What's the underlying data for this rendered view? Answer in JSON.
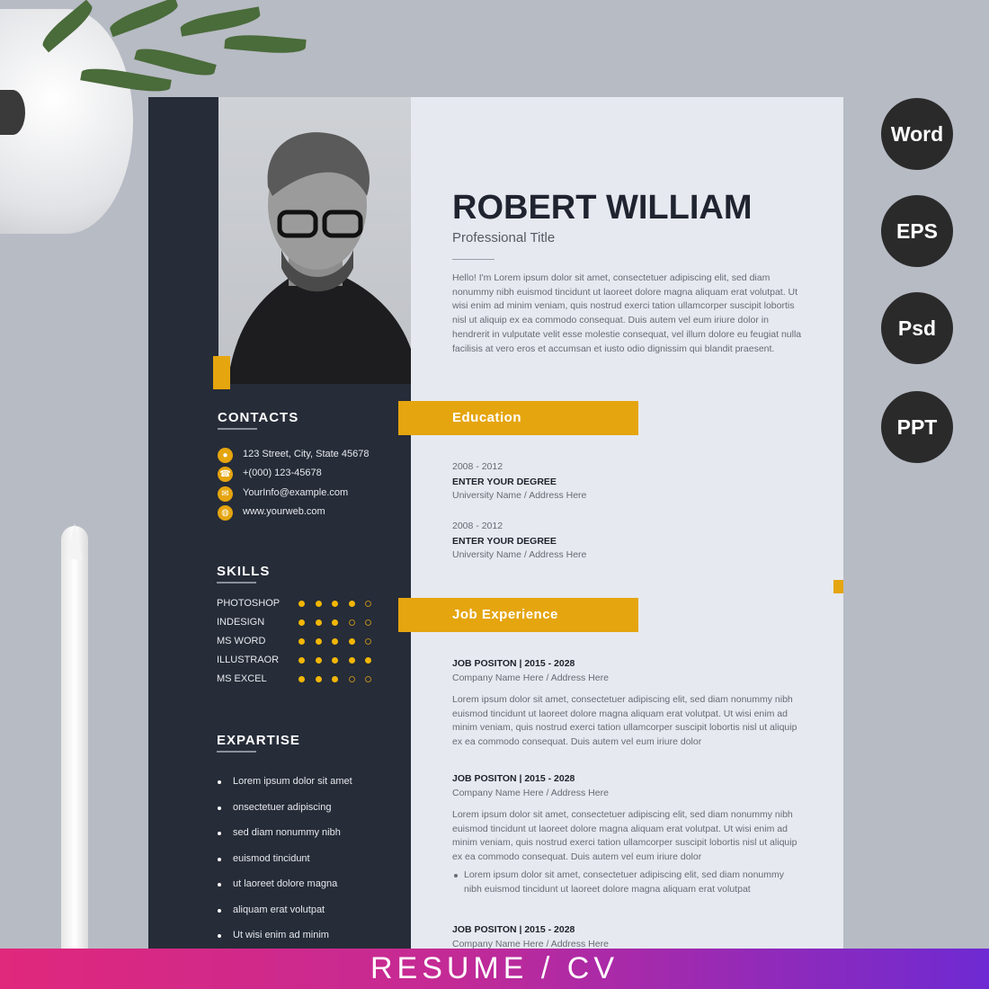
{
  "resume": {
    "name": "ROBERT WILLIAM",
    "title": "Professional Title",
    "about": "Hello! I'm Lorem ipsum dolor sit amet, consectetuer adipiscing elit, sed diam nonummy nibh euismod tincidunt ut laoreet dolore magna aliquam erat volutpat. Ut wisi enim ad minim veniam, quis nostrud exerci tation ullamcorper suscipit lobortis nisl ut aliquip ex ea commodo consequat. Duis autem vel eum iriure dolor in hendrerit in vulputate velit esse molestie consequat, vel illum dolore eu feugiat nulla facilisis at vero eros et accumsan et iusto odio dignissim qui blandit praesent.",
    "contacts_heading": "CONTACTS",
    "contacts": [
      {
        "icon": "location-pin-icon",
        "glyph": "●",
        "text": "123 Street, City, State 45678"
      },
      {
        "icon": "phone-icon",
        "glyph": "☎",
        "text": "+(000) 123-45678"
      },
      {
        "icon": "mail-icon",
        "glyph": "✉",
        "text": "YourInfo@example.com"
      },
      {
        "icon": "globe-icon",
        "glyph": "◍",
        "text": "www.yourweb.com"
      }
    ],
    "skills_heading": "SKILLS",
    "skills": [
      {
        "name": "PHOTOSHOP",
        "level": 4
      },
      {
        "name": "INDESIGN",
        "level": 3
      },
      {
        "name": "MS WORD",
        "level": 4
      },
      {
        "name": "ILLUSTRAOR",
        "level": 5
      },
      {
        "name": "MS EXCEL",
        "level": 3
      }
    ],
    "skills_max": 5,
    "expertise_heading": "EXPARTISE",
    "expertise": [
      "Lorem ipsum dolor sit amet",
      "onsectetuer adipiscing",
      "sed diam nonummy nibh",
      "euismod tincidunt",
      "ut laoreet dolore magna",
      "aliquam erat volutpat",
      "Ut wisi enim ad minim"
    ],
    "education_heading": "Education",
    "education": [
      {
        "years": "2008 - 2012",
        "degree": "ENTER YOUR DEGREE",
        "place": "University Name  / Address Here"
      },
      {
        "years": "2008 - 2012",
        "degree": "ENTER YOUR DEGREE",
        "place": "University Name  / Address Here"
      }
    ],
    "job_heading": "Job Experience",
    "jobs": [
      {
        "title": "JOB POSITON | 2015 - 2028",
        "company": "Company Name Here  / Address Here",
        "desc": "Lorem ipsum dolor sit amet, consectetuer adipiscing elit, sed diam nonummy nibh euismod tincidunt ut laoreet dolore magna aliquam erat volutpat. Ut wisi enim ad minim veniam, quis nostrud exerci tation ullamcorper suscipit lobortis nisl ut aliquip ex ea commodo consequat. Duis autem vel eum iriure dolor",
        "bullet": ""
      },
      {
        "title": "JOB POSITON | 2015 - 2028",
        "company": "Company Name Here  / Address Here",
        "desc": "Lorem ipsum dolor sit amet, consectetuer adipiscing elit, sed diam nonummy nibh euismod tincidunt ut laoreet dolore magna aliquam erat volutpat. Ut wisi enim ad minim veniam, quis nostrud exerci tation ullamcorper suscipit lobortis nisl ut aliquip ex ea commodo consequat. Duis autem vel eum iriure dolor",
        "bullet": "Lorem ipsum dolor sit amet, consectetuer adipiscing elit, sed diam nonummy nibh euismod tincidunt ut laoreet dolore magna aliquam erat volutpat"
      },
      {
        "title": "JOB POSITON | 2015 - 2028",
        "company": "Company Name Here  / Address Here",
        "desc": "",
        "bullet": ""
      }
    ]
  },
  "formats": [
    "Word",
    "EPS",
    "Psd",
    "PPT"
  ],
  "banner": "RESUME / CV",
  "colors": {
    "accent": "#e5a50f",
    "sidebar": "#262c38",
    "paper": "#e6e9ef"
  }
}
